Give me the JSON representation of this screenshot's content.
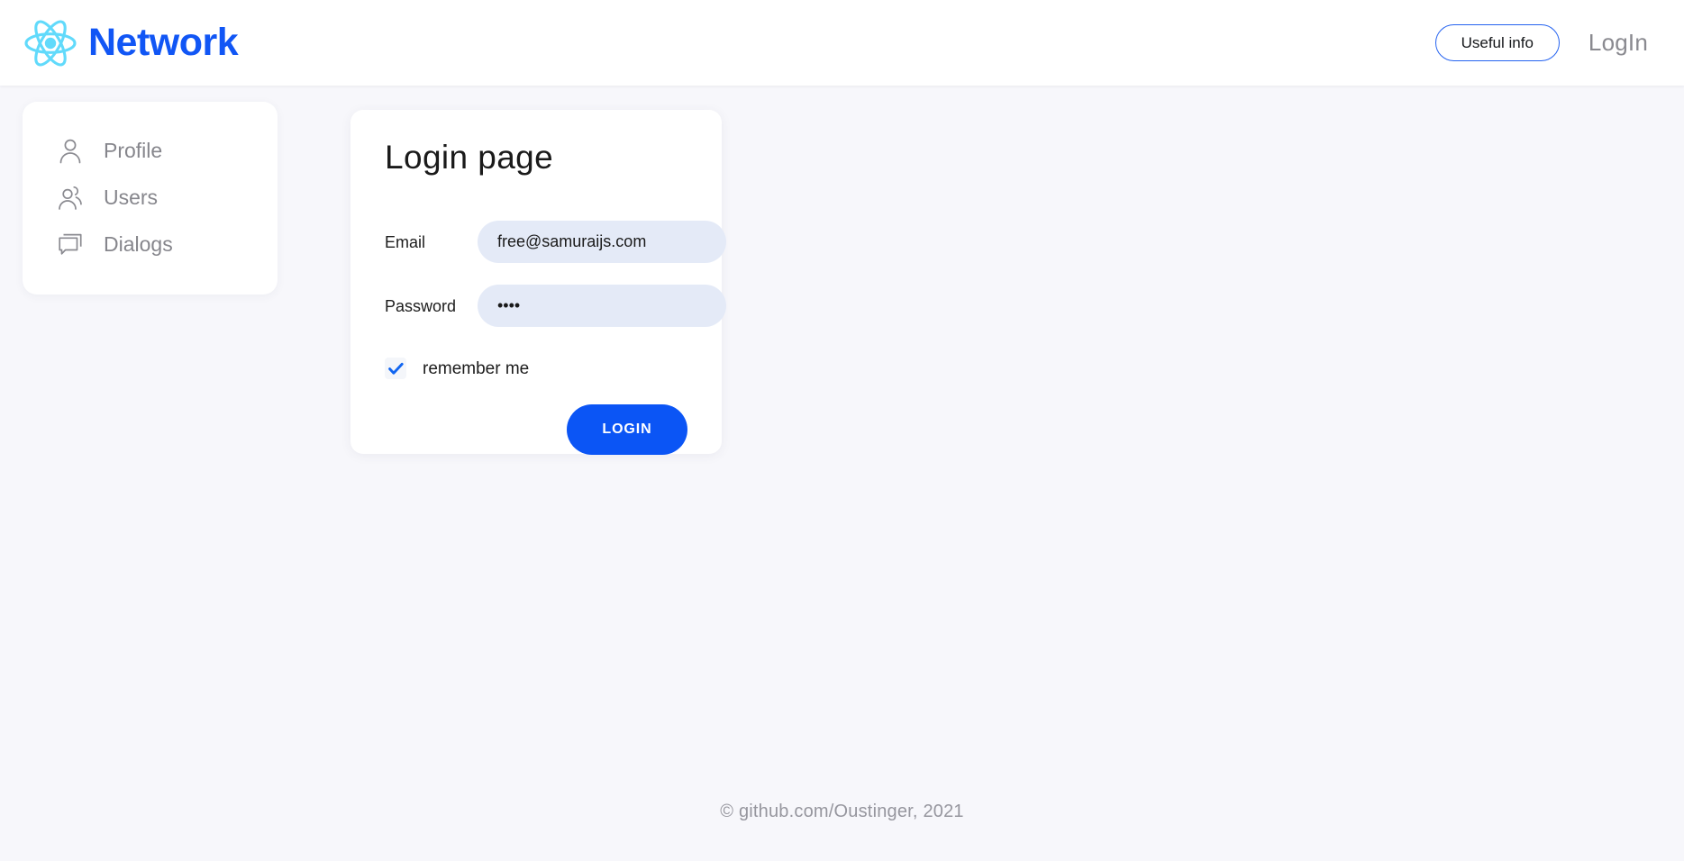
{
  "header": {
    "logo_icon": "react-atom-icon",
    "brand_name": "Network",
    "useful_info_label": "Useful info",
    "login_link_label": "LogIn",
    "brand_color": "#1156f5",
    "logo_color": "#61dafb"
  },
  "sidebar": {
    "items": [
      {
        "label": "Profile",
        "icon": "person-icon"
      },
      {
        "label": "Users",
        "icon": "people-icon"
      },
      {
        "label": "Dialogs",
        "icon": "chat-bubble-icon"
      }
    ]
  },
  "login_form": {
    "title": "Login page",
    "email": {
      "label": "Email",
      "value": "free@samuraijs.com",
      "placeholder": "Email"
    },
    "password": {
      "label": "Password",
      "value": "••••",
      "placeholder": "Password"
    },
    "remember_me": {
      "label": "remember me",
      "checked": true,
      "check_color": "#1266f1"
    },
    "submit_label": "LOGIN",
    "submit_color": "#0b55f5",
    "input_background": "#e4eaf7"
  },
  "footer": {
    "text": "© github.com/Oustinger, 2021"
  },
  "page": {
    "background": "#f7f7fb"
  }
}
